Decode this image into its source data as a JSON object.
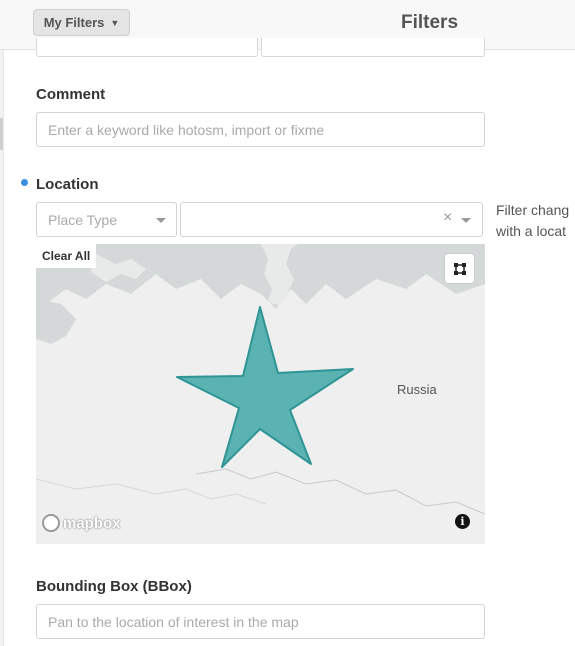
{
  "header": {
    "my_filters_label": "My Filters",
    "title": "Filters"
  },
  "comment": {
    "label": "Comment",
    "placeholder": "Enter a keyword like hotosm, import or fixme"
  },
  "location": {
    "label": "Location",
    "place_type_placeholder": "Place Type",
    "place_value": "",
    "clear_symbol": "×",
    "note_line1": "Filter chang",
    "note_line2": "with a locat"
  },
  "map": {
    "clear_all_label": "Clear All",
    "country_label": "Russia",
    "attribution_logo": "mapbox",
    "info_symbol": "i",
    "polygon_color": "#41a7a7"
  },
  "bbox": {
    "label": "Bounding Box (BBox)",
    "placeholder": "Pan to the location of interest in the map"
  }
}
